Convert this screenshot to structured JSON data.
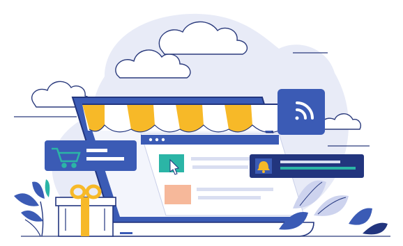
{
  "illustration": {
    "subject": "online-store",
    "colors": {
      "primary_blue": "#3b5bb5",
      "navy": "#22357e",
      "awning_yellow": "#f7b928",
      "teal": "#2bb5a6",
      "salmon": "#f6b89a",
      "blob": "#e8ebf7",
      "light_bar": "#d9def1",
      "outline": "#2a3a7c"
    },
    "icons": [
      "wifi-icon",
      "shopping-cart-icon",
      "cursor-click-icon",
      "bell-icon",
      "gift-box-icon",
      "cloud-icon",
      "leaf-plant-icon"
    ]
  }
}
